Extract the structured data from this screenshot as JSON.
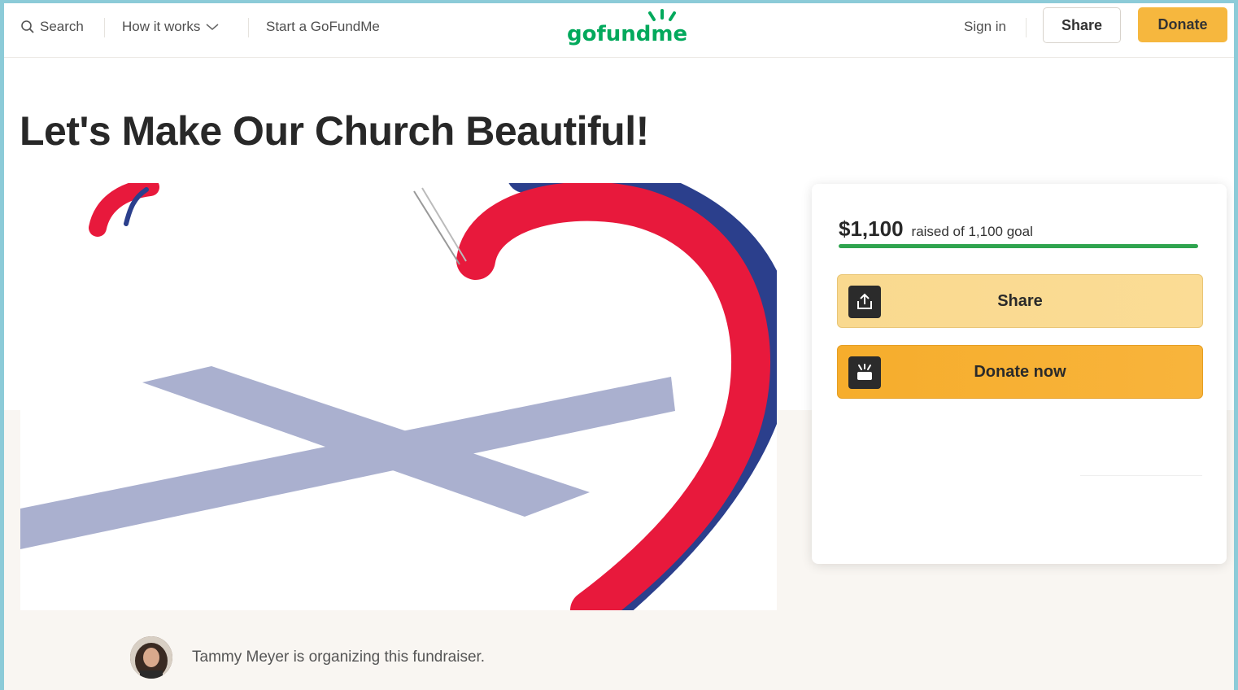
{
  "header": {
    "search_label": "Search",
    "how_it_works_label": "How it works",
    "start_label": "Start a GoFundMe",
    "logo_text": "gofundme",
    "signin_label": "Sign in",
    "share_label": "Share",
    "donate_label": "Donate"
  },
  "campaign": {
    "title": "Let's Make Our Church Beautiful!",
    "organizer_text": "Tammy Meyer is organizing this fundraiser."
  },
  "donation": {
    "amount": "$1,100",
    "raised_text": "raised of 1,100 goal",
    "progress_fraction": 1.0,
    "share_label": "Share",
    "donate_label": "Donate now"
  },
  "colors": {
    "brand_green": "#02a95c",
    "donate_orange": "#f6b73e",
    "progress_green": "#2fa44f",
    "heart_red": "#e8193c",
    "heart_blue": "#2b3f8c",
    "cross_gray": "#aab0cf"
  }
}
